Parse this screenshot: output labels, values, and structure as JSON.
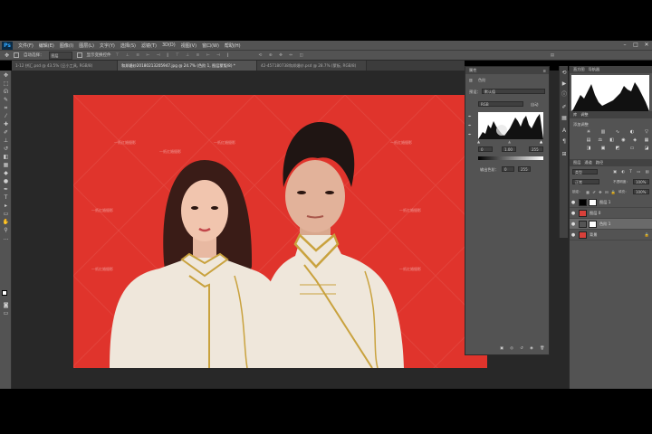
{
  "app": {
    "logo": "Ps"
  },
  "menu": [
    "文件(F)",
    "编辑(E)",
    "图像(I)",
    "图层(L)",
    "文字(Y)",
    "选择(S)",
    "滤镜(T)",
    "3D(D)",
    "视图(V)",
    "窗口(W)",
    "帮助(H)"
  ],
  "options_bar": {
    "auto_select_label": "自动选择：",
    "auto_select_value": "图层",
    "transform_label": "显示变换控件"
  },
  "tabs": [
    {
      "label": "1-12 拼汇.psd @ 43.5% (旦小工具, RGB/8)",
      "active": false
    },
    {
      "label": "和邦婚纱20180213205947.jpg @ 24.7% (色阶 1, 图层蒙版/8) *",
      "active": true
    },
    {
      "label": "42-457180738和邦婚纱.psd @ 28.7% (蒙板, RGB/8)",
      "active": false
    }
  ],
  "properties": {
    "title": "属性",
    "panel": "色阶",
    "preset_label": "预设：",
    "preset_value": "默认值",
    "channel": "RGB",
    "auto": "自动",
    "input_levels": [
      "0",
      "1.00",
      "255"
    ],
    "output_label": "输出色阶：",
    "output_levels": [
      "0",
      "255"
    ]
  },
  "right_panels": {
    "histogram_tabs": [
      "直方图",
      "导航器"
    ],
    "adjust_tabs": [
      "库",
      "调整"
    ],
    "adjust_add": "添加调整",
    "layers_tabs": [
      "图层",
      "通道",
      "路径"
    ],
    "kind_label": "类型",
    "blend_mode": "正常",
    "opacity_label": "不透明度：",
    "opacity_value": "100%",
    "lock_label": "锁定：",
    "fill_label": "填充：",
    "fill_value": "100%",
    "layers": [
      {
        "name": "图层 1",
        "visible": true
      },
      {
        "name": "图层 0",
        "visible": true
      },
      {
        "name": "色阶 1",
        "visible": true
      },
      {
        "name": "背景",
        "visible": true
      }
    ]
  },
  "watermark": "一纸红婚摄影",
  "colors": {
    "photo_bg": "#e0342c",
    "panel": "#535353",
    "dark": "#424242",
    "workspace": "#282828"
  }
}
